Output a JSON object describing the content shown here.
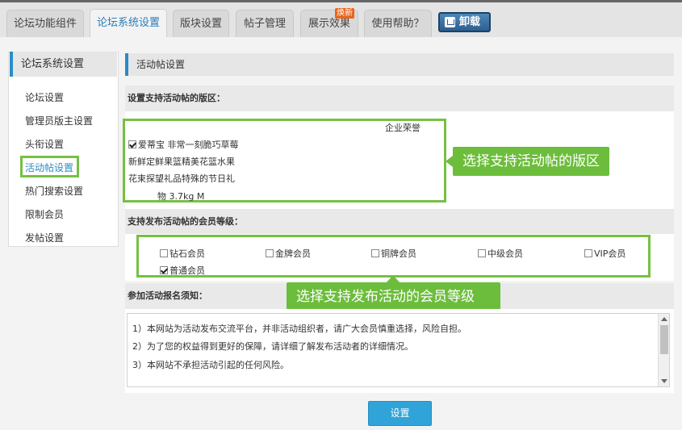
{
  "tabs": [
    {
      "label": "论坛功能组件",
      "active": false
    },
    {
      "label": "论坛系统设置",
      "active": true
    },
    {
      "label": "版块设置",
      "active": false
    },
    {
      "label": "帖子管理",
      "active": false
    },
    {
      "label": "展示效果",
      "active": false,
      "badge": "焕新"
    },
    {
      "label": "使用帮助？",
      "active": false
    }
  ],
  "uninstall_label": "卸载",
  "sidebar": {
    "title": "论坛系统设置",
    "items": [
      "论坛设置",
      "管理员版主设置",
      "头衔设置",
      "活动帖设置",
      "热门搜索设置",
      "限制会员",
      "发帖设置"
    ],
    "active_index": 3
  },
  "content": {
    "title": "活动帖设置",
    "forum_section_label": "设置支持活动帖的版区：",
    "forum_lines": {
      "line0": "企业荣誉",
      "line1": "爱蒂宝 非常一刻脆巧草莓",
      "line2": "新鲜定鲜果篮精美花篮水果",
      "line3": "花束探望礼品特殊的节日礼",
      "line4": "物 3.7kg M"
    },
    "forum_checked": true,
    "callout_forum": "选择支持活动帖的版区",
    "member_section_label": "支持发布活动帖的会员等级：",
    "members": [
      {
        "label": "钻石会员",
        "checked": false
      },
      {
        "label": "金牌会员",
        "checked": false
      },
      {
        "label": "铜牌会员",
        "checked": false
      },
      {
        "label": "中级会员",
        "checked": false
      },
      {
        "label": "VIP会员",
        "checked": false
      },
      {
        "label": "普通会员",
        "checked": true
      }
    ],
    "callout_member": "选择支持发布活动的会员等级",
    "notice_section_label": "参加活动报名须知：",
    "notice_lines": [
      "1）本网站为活动发布交流平台，并非活动组织者，请广大会员慎重选择，风险自担。",
      "2）为了您的权益得到更好的保障，请详细了解发布活动者的详细情况。",
      "3）本网站不承担活动引起的任何风险。"
    ],
    "submit_label": "设置"
  },
  "colors": {
    "accent": "#2a8bc7",
    "highlight": "#76c043",
    "button": "#30a4d8",
    "badge": "#e8651c"
  }
}
